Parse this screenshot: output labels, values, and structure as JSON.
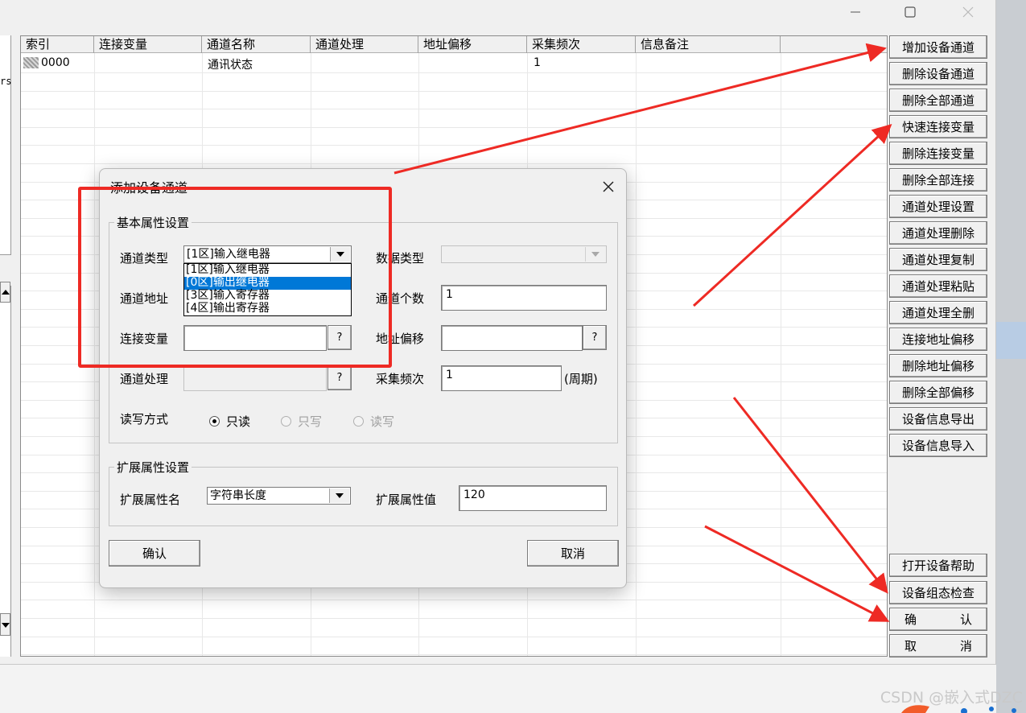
{
  "window": {
    "left_sliver_text": "rs"
  },
  "grid": {
    "columns": [
      "索引",
      "连接变量",
      "通道名称",
      "通道处理",
      "地址偏移",
      "采集频次",
      "信息备注"
    ],
    "rows": [
      {
        "index": "0000",
        "variable": "",
        "name": "通讯状态",
        "process": "",
        "offset": "",
        "freq": "1",
        "note": ""
      }
    ]
  },
  "right_buttons": [
    "增加设备通道",
    "删除设备通道",
    "删除全部通道",
    "快速连接变量",
    "删除连接变量",
    "删除全部连接",
    "通道处理设置",
    "通道处理删除",
    "通道处理复制",
    "通道处理粘贴",
    "通道处理全删",
    "连接地址偏移",
    "删除地址偏移",
    "删除全部偏移",
    "设备信息导出",
    "设备信息导入"
  ],
  "bottom_buttons": {
    "help": "打开设备帮助",
    "check": "设备组态检查",
    "ok_a": "确",
    "ok_b": "认",
    "cancel_a": "取",
    "cancel_b": "消"
  },
  "dialog": {
    "title": "添加设备通道",
    "basic_group": "基本属性设置",
    "channel_type_label": "通道类型",
    "channel_type_value": "[1区]输入继电器",
    "channel_type_options": [
      "[1区]输入继电器",
      "[0区]输出继电器",
      "[3区]输入寄存器",
      "[4区]输出寄存器"
    ],
    "channel_type_selected_index": 1,
    "data_type_label": "数据类型",
    "data_type_value": "",
    "channel_addr_label": "通道地址",
    "channel_count_label": "通道个数",
    "channel_count_value": "1",
    "link_var_label": "连接变量",
    "link_var_value": "",
    "addr_offset_label": "地址偏移",
    "addr_offset_value": "",
    "channel_proc_label": "通道处理",
    "channel_proc_value": "",
    "collect_freq_label": "采集频次",
    "collect_freq_value": "1",
    "period_label": "(周期)",
    "question": "?",
    "rw_label": "读写方式",
    "rw_options": [
      "只读",
      "只写",
      "读写"
    ],
    "rw_selected": "只读",
    "ext_group": "扩展属性设置",
    "ext_name_label": "扩展属性名",
    "ext_name_value": "字符串长度",
    "ext_value_label": "扩展属性值",
    "ext_value_value": "120",
    "ok": "确认",
    "cancel": "取消"
  },
  "overlay": {
    "highlight_color": "#ee2a24",
    "watermark": "CSDN @嵌入式DZC"
  }
}
